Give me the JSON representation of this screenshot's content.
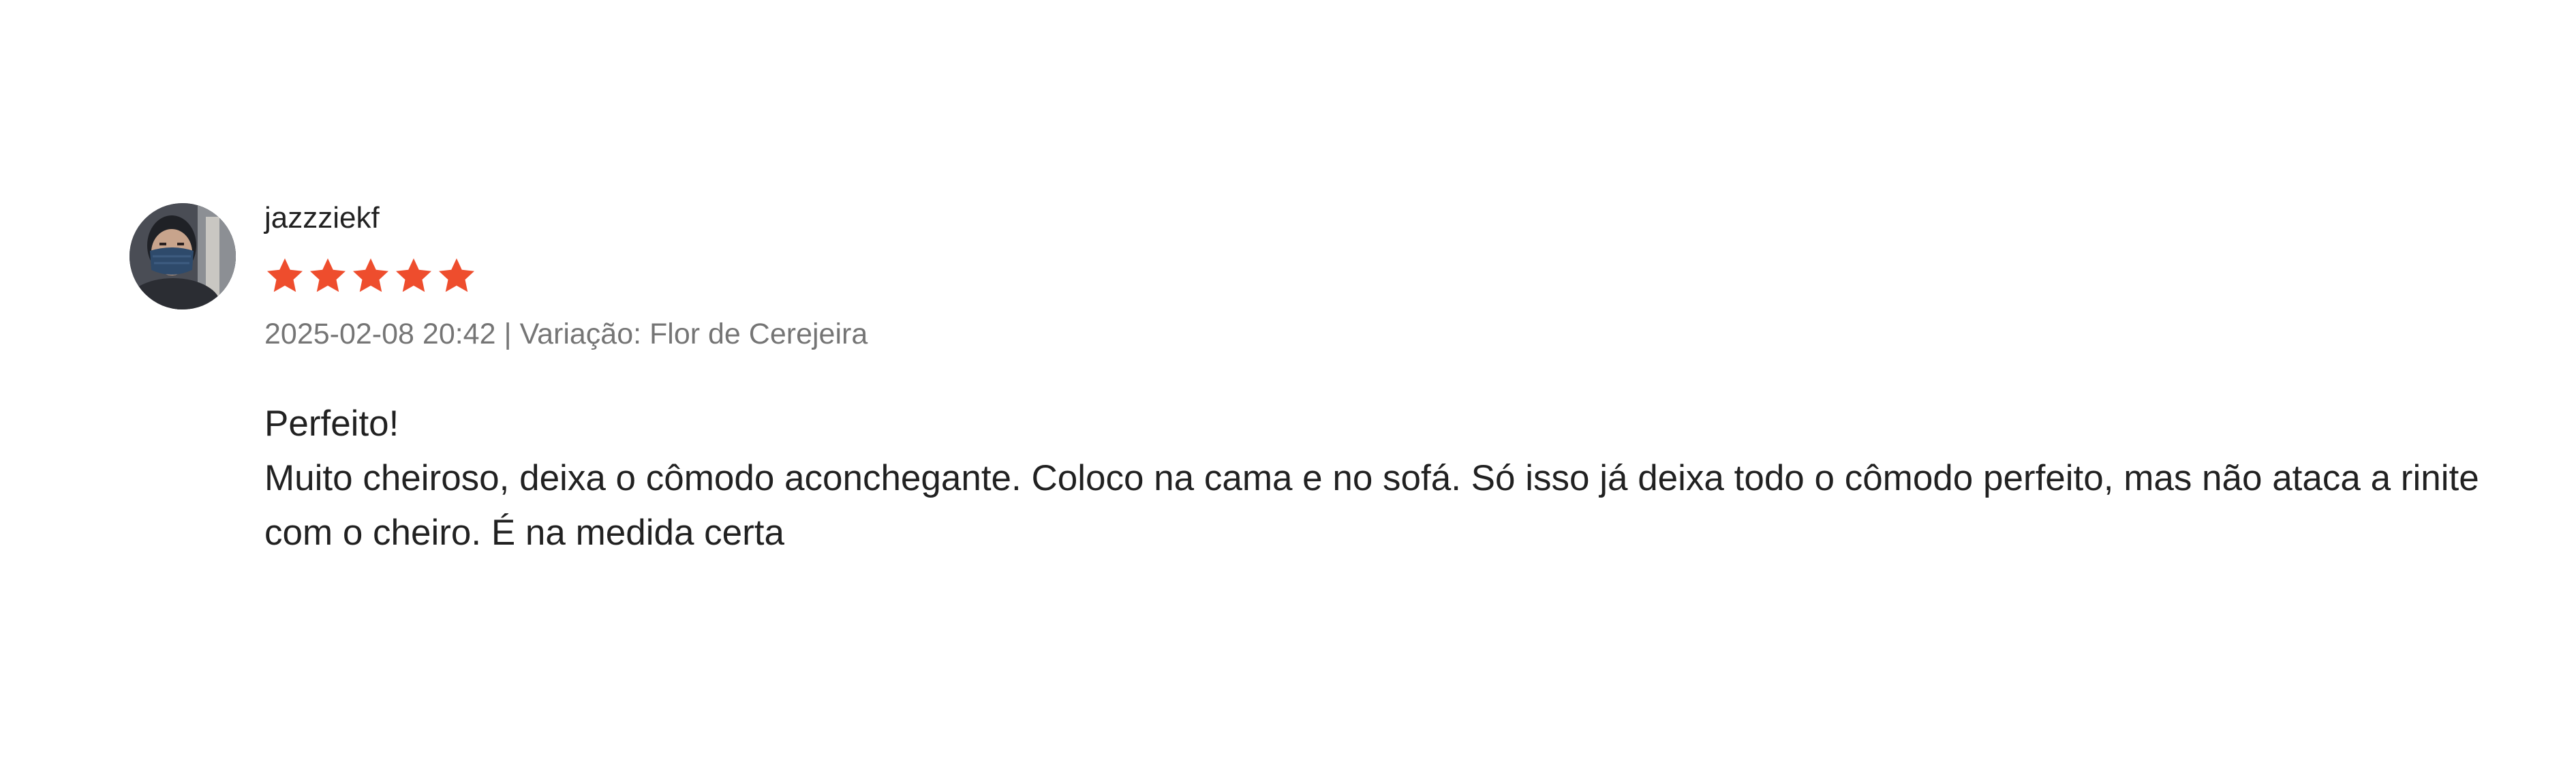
{
  "review": {
    "username": "jazzziekf",
    "avatar_icon": "user-avatar-photo",
    "rating": 5,
    "rating_max": 5,
    "star_color": "#ee4d2d",
    "date": "2025-02-08 20:42",
    "separator": "|",
    "variation_label": "Variação: Flor de Cerejeira",
    "title": "Perfeito!",
    "text": "Muito cheiroso, deixa o cômodo aconchegante. Coloco na cama e no sofá. Só isso já deixa todo o cômodo perfeito, mas não ataca a rinite com o cheiro. É na medida certa"
  }
}
